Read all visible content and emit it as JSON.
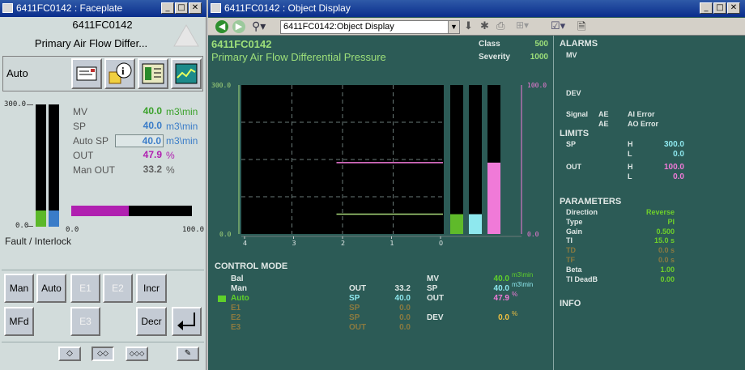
{
  "faceplate": {
    "title": "6411FC0142 : Faceplate",
    "tag": "6411FC0142",
    "description": "Primary Air Flow Differ...",
    "mode": "Auto",
    "scale_top": "300.0",
    "scale_bottom": "0.0",
    "bar_scale_min": "0.0",
    "bar_scale_max": "100.0",
    "mv_fraction": 0.133,
    "sp_fraction": 0.133,
    "out_fraction": 0.479,
    "status": "Fault / Interlock",
    "values": [
      {
        "label": "MV",
        "value": "40.0",
        "unit": "m3\\min",
        "color": "#3aa12a"
      },
      {
        "label": "SP",
        "value": "40.0",
        "unit": "m3\\min",
        "color": "#3a7cc8"
      },
      {
        "label": "Auto SP",
        "value": "40.0",
        "unit": "m3\\min",
        "color": "#3a7cc8"
      },
      {
        "label": "OUT",
        "value": "47.9",
        "unit": "%",
        "color": "#b020b0"
      },
      {
        "label": "Man OUT",
        "value": "33.2",
        "unit": "%",
        "color": "#606060"
      }
    ],
    "buttons": {
      "man": "Man",
      "auto": "Auto",
      "e1": "E1",
      "e2": "E2",
      "incr": "Incr",
      "mfd": "MFd",
      "e3": "E3",
      "decr": "Decr"
    }
  },
  "object_display": {
    "title": "6411FC0142 : Object Display",
    "address": "6411FC0142:Object Display",
    "tag": "6411FC0142",
    "description": "Primary Air Flow Differential Pressure",
    "class_label": "Class",
    "class_value": "500",
    "severity_label": "Severity",
    "severity_value": "1000",
    "trend": {
      "y_left_top": "300.0",
      "y_left_bottom": "0.0",
      "y_right_top": "100.0",
      "y_right_bottom": "0.0",
      "x_ticks": [
        "4",
        "3",
        "2",
        "1",
        "0"
      ],
      "out_level": 0.479,
      "pv_level": 0.133,
      "bars": [
        {
          "fraction": 0.133,
          "color": "#5fba2a"
        },
        {
          "fraction": 0.133,
          "color": "#8ee8ee"
        },
        {
          "fraction": 0.479,
          "color": "#f07ad8"
        }
      ]
    },
    "control_mode": {
      "heading": "CONTROL MODE",
      "modes": [
        {
          "name": "Bal",
          "active": false,
          "enabled": true
        },
        {
          "name": "Man",
          "active": false,
          "enabled": true
        },
        {
          "name": "Auto",
          "active": true,
          "enabled": true
        },
        {
          "name": "E1",
          "active": false,
          "enabled": false
        },
        {
          "name": "E2",
          "active": false,
          "enabled": false
        },
        {
          "name": "E3",
          "active": false,
          "enabled": false
        }
      ],
      "mode_values": [
        {
          "label": "",
          "value": ""
        },
        {
          "label": "OUT",
          "value": "33.2"
        },
        {
          "label": "SP",
          "value": "40.0"
        },
        {
          "label": "SP",
          "value": "0.0"
        },
        {
          "label": "SP",
          "value": "0.0"
        },
        {
          "label": "OUT",
          "value": "0.0"
        }
      ],
      "readouts": [
        {
          "label": "MV",
          "value": "40.0",
          "unit": "m3\\min",
          "color": "#5fd02a"
        },
        {
          "label": "SP",
          "value": "40.0",
          "unit": "m3\\min",
          "color": "#8ee8ee"
        },
        {
          "label": "OUT",
          "value": "47.9",
          "unit": "%",
          "color": "#f07ad8"
        },
        {
          "label": "DEV",
          "value": "0.0",
          "unit": "%",
          "color": "#f0c040"
        }
      ]
    },
    "alarms": {
      "heading": "ALARMS",
      "mv": "MV",
      "dev": "DEV",
      "signal": "Signal",
      "ae1": "AE",
      "ai_error": "AI Error",
      "ae2": "AE",
      "ao_error": "AO Error"
    },
    "limits": {
      "heading": "LIMITS",
      "rows": [
        {
          "name": "SP",
          "hl": "H",
          "value": "300.0",
          "color": "#8ee8ee"
        },
        {
          "name": "",
          "hl": "L",
          "value": "0.0",
          "color": "#8ee8ee"
        },
        {
          "name": "OUT",
          "hl": "H",
          "value": "100.0",
          "color": "#f07ad8"
        },
        {
          "name": "",
          "hl": "L",
          "value": "0.0",
          "color": "#f07ad8"
        }
      ]
    },
    "parameters": {
      "heading": "PARAMETERS",
      "rows": [
        {
          "name": "Direction",
          "value": "Reverse",
          "active": true
        },
        {
          "name": "Type",
          "value": "PI",
          "active": true
        },
        {
          "name": "Gain",
          "value": "0.500",
          "active": true
        },
        {
          "name": "TI",
          "value": "15.0 s",
          "active": true
        },
        {
          "name": "TD",
          "value": "0.0 s",
          "active": false
        },
        {
          "name": "TF",
          "value": "0.0 s",
          "active": false
        },
        {
          "name": "Beta",
          "value": "1.00",
          "active": true
        },
        {
          "name": "TI DeadB",
          "value": "0.00",
          "active": true
        }
      ]
    },
    "info": {
      "heading": "INFO"
    }
  }
}
